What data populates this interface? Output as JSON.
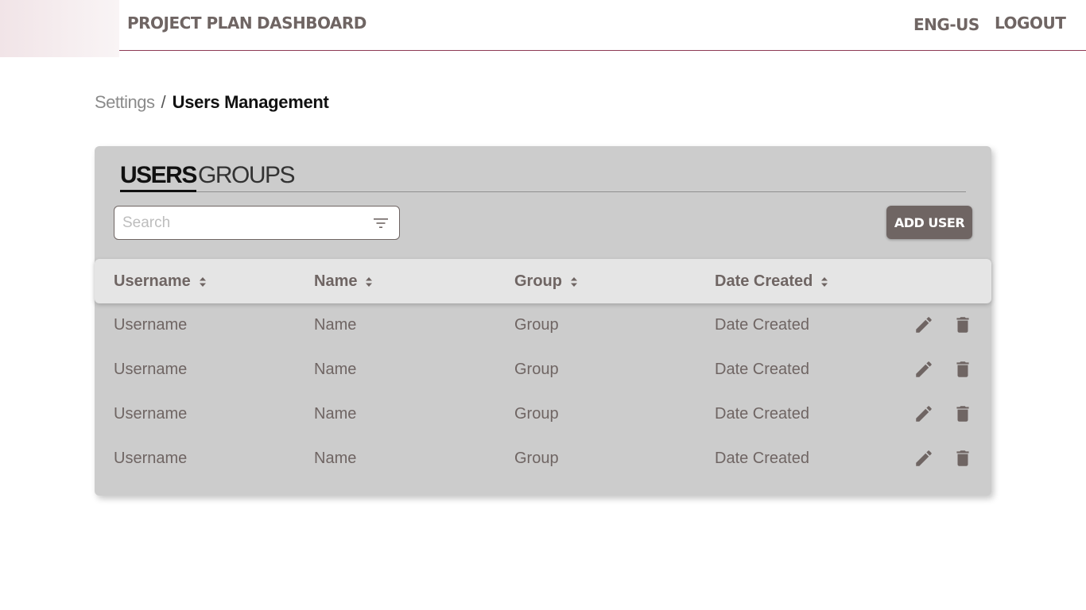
{
  "nav": {
    "project_plan": "PROJECT PLAN",
    "dashboard": "DASHBOARD",
    "language": "ENG-US",
    "logout": "LOGOUT"
  },
  "breadcrumb": {
    "parent": "Settings",
    "separator": "/",
    "current": "Users Management"
  },
  "tabs": {
    "users": "USERS",
    "groups": "GROUPS",
    "active": "USERS"
  },
  "search": {
    "placeholder": "Search",
    "value": "",
    "icon": "filter-icon"
  },
  "add_user_label": "ADD USER",
  "table": {
    "headers": [
      "Username",
      "Name",
      "Group",
      "Date Created"
    ],
    "rows": [
      [
        "Username",
        "Name",
        "Group",
        "Date Created"
      ],
      [
        "Username",
        "Name",
        "Group",
        "Date Created"
      ],
      [
        "Username",
        "Name",
        "Group",
        "Date Created"
      ],
      [
        "Username",
        "Name",
        "Group",
        "Date Created"
      ]
    ],
    "row_actions": [
      "pencil-icon",
      "trash-icon"
    ]
  },
  "colors": {
    "accent": "#6f6563",
    "card": "#cccccc",
    "header_row": "#e5e5e5",
    "nav_underline": "#8e3a55"
  }
}
